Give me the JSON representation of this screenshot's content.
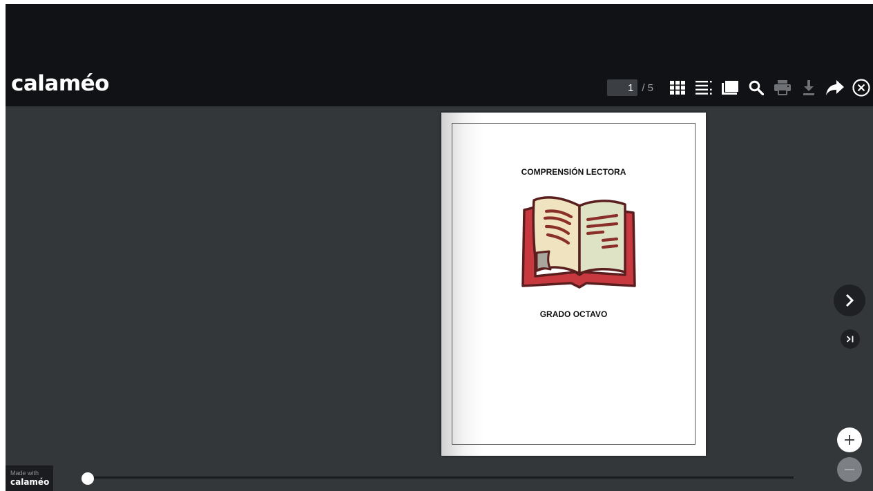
{
  "app": {
    "logo_text": "calaméo",
    "accent_color": "#c8d400"
  },
  "toolbar": {
    "current_page": "1",
    "page_total": "/ 5",
    "icons": [
      "grid-view-icon",
      "table-of-contents-icon",
      "library-icon",
      "search-icon",
      "print-icon",
      "download-icon",
      "share-icon",
      "close-icon"
    ],
    "disabled_icons": [
      "print-icon",
      "download-icon"
    ]
  },
  "document": {
    "title": "COMPRENSIÓN LECTORA",
    "subtitle": "GRADO OCTAVO",
    "illustration": "open-book-icon",
    "colors": {
      "book_cover": "#c8393f",
      "left_page": "#efe3c0",
      "right_page": "#dde3c4",
      "outline": "#5a1e1e"
    }
  },
  "navigation": {
    "next_icon": "chevron-right-icon",
    "last_icon": "skip-to-end-icon",
    "zoom_in_icon": "plus-icon",
    "zoom_out_icon": "minus-icon",
    "progress": 0.0
  },
  "footer": {
    "made_with_label": "Made with",
    "made_with_logo": "calaméo"
  }
}
